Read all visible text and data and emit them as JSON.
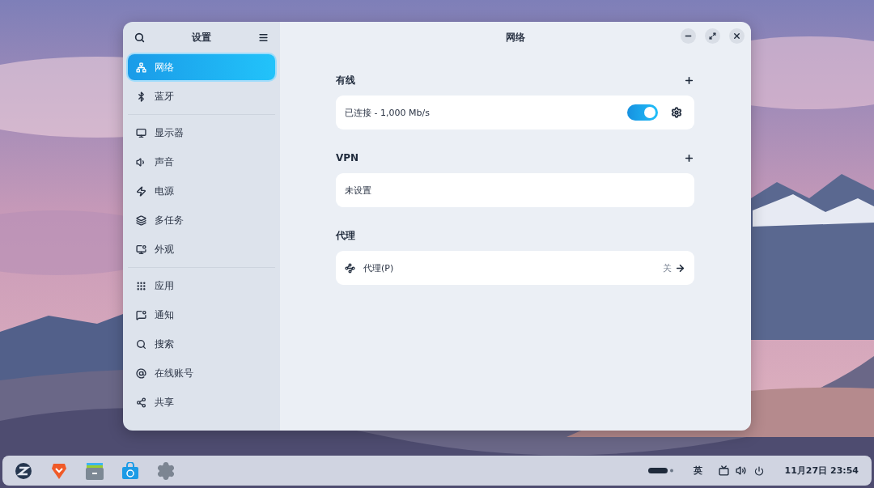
{
  "sidebar": {
    "title": "设置",
    "groups": [
      {
        "items": [
          {
            "label": "网络",
            "selected": true
          },
          {
            "label": "蓝牙",
            "selected": false
          }
        ]
      },
      {
        "items": [
          {
            "label": "显示器",
            "selected": false
          },
          {
            "label": "声音",
            "selected": false
          },
          {
            "label": "电源",
            "selected": false
          },
          {
            "label": "多任务",
            "selected": false
          },
          {
            "label": "外观",
            "selected": false
          }
        ]
      },
      {
        "items": [
          {
            "label": "应用",
            "selected": false
          },
          {
            "label": "通知",
            "selected": false
          },
          {
            "label": "搜索",
            "selected": false
          },
          {
            "label": "在线账号",
            "selected": false
          },
          {
            "label": "共享",
            "selected": false
          }
        ]
      }
    ]
  },
  "page": {
    "title": "网络",
    "sections": [
      {
        "title": "有线",
        "addable": true,
        "rows": [
          {
            "kind": "toggle",
            "label": "已连接 - 1,000 Mb/s",
            "on": true
          }
        ]
      },
      {
        "title": "VPN",
        "addable": true,
        "rows": [
          {
            "kind": "text",
            "label": "未设置"
          }
        ]
      },
      {
        "title": "代理",
        "addable": false,
        "rows": [
          {
            "kind": "link",
            "label": "代理(P)",
            "value": "关"
          }
        ]
      }
    ]
  },
  "taskbar": {
    "input_method": "英",
    "clock": "11月27日 23:54"
  }
}
